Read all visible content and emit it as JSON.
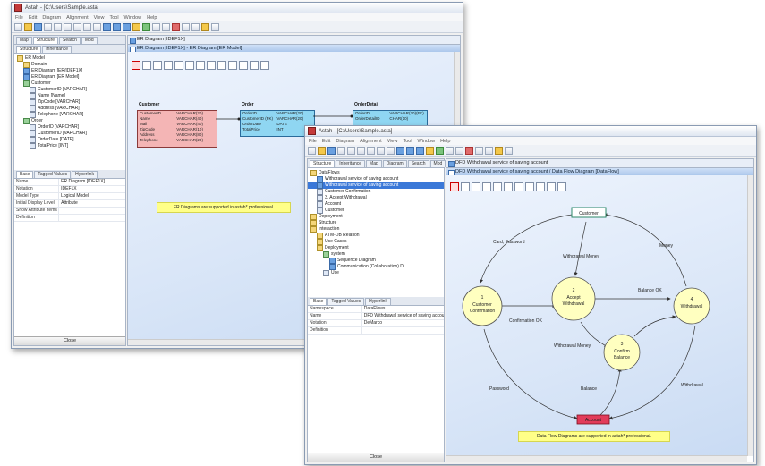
{
  "back_window": {
    "title": "Astah - [C:\\Users\\Sample.asta]",
    "menu": [
      "File",
      "Edit",
      "Diagram",
      "Alignment",
      "View",
      "Tool",
      "Window",
      "Help"
    ],
    "left_tabs": [
      "Map",
      "Structure",
      "Search",
      "Mod"
    ],
    "left_subtabs": [
      "Structure",
      "Inheritance"
    ],
    "tree": [
      {
        "label": "ER Model",
        "icon": "folder",
        "indent": 0
      },
      {
        "label": "Domain",
        "icon": "folder",
        "indent": 1
      },
      {
        "label": "ER Diagram [ER/IDEF1X]",
        "icon": "diagram",
        "indent": 1
      },
      {
        "label": "ER Diagram [ER Model]",
        "icon": "diagram",
        "indent": 1
      },
      {
        "label": "Customer",
        "icon": "entity",
        "indent": 1
      },
      {
        "label": "CustomerID [VARCHAR]",
        "icon": "attr",
        "indent": 2
      },
      {
        "label": "Name [Name]",
        "icon": "attr",
        "indent": 2
      },
      {
        "label": "ZipCode [VARCHAR]",
        "icon": "attr",
        "indent": 2
      },
      {
        "label": "Address [VARCHAR]",
        "icon": "attr",
        "indent": 2
      },
      {
        "label": "Telephone [VARCHAR]",
        "icon": "attr",
        "indent": 2
      },
      {
        "label": "Order",
        "icon": "entity",
        "indent": 1
      },
      {
        "label": "OrderID [VARCHAR]",
        "icon": "attr",
        "indent": 2
      },
      {
        "label": "CustomerID [VARCHAR]",
        "icon": "attr",
        "indent": 2
      },
      {
        "label": "OrderDate [DATE]",
        "icon": "attr",
        "indent": 2
      },
      {
        "label": "TotalPrice [INT]",
        "icon": "attr",
        "indent": 2
      }
    ],
    "prop_tabs": [
      "Base",
      "Tagged Values",
      "Hyperlink"
    ],
    "props": [
      {
        "k": "Name",
        "v": "ER Diagram [IDEF1X]"
      },
      {
        "k": "Notation",
        "v": "IDEF1X"
      },
      {
        "k": "Model Type",
        "v": "Logical Model"
      },
      {
        "k": "Initial Display Level",
        "v": "Attribute"
      },
      {
        "k": "Show Attribute Items",
        "v": ""
      },
      {
        "k": "Definition",
        "v": ""
      }
    ],
    "close_label": "Close",
    "doc_tab": "ER Diagram [IDEF1X]",
    "diagram_title": "ER Diagram [IDEF1X] - ER Diagram [ER Model]",
    "entities": {
      "customer": {
        "title": "Customer",
        "rows": [
          [
            "CustomerID",
            "VARCHAR(20)"
          ],
          [
            "Name",
            "VARCHAR(40)"
          ],
          [
            "Mail",
            "VARCHAR(40)"
          ],
          [
            "ZipCode",
            "VARCHAR(10)"
          ],
          [
            "Address",
            "VARCHAR(80)"
          ],
          [
            "Telephone",
            "VARCHAR(20)"
          ]
        ]
      },
      "order": {
        "title": "Order",
        "rows": [
          [
            "OrderID",
            "VARCHAR(20)"
          ],
          [
            "CustomerID (FK)",
            "VARCHAR(20)"
          ],
          [
            "OrderDate",
            "DATE"
          ],
          [
            "TotalPrice",
            "INT"
          ]
        ]
      },
      "orderdetail": {
        "title": "OrderDetail",
        "rows": [
          [
            "OrderID",
            "VARCHAR(20)(FK)"
          ],
          [
            "OrderDetailID",
            "CHAR(10)"
          ]
        ]
      }
    },
    "note": "ER Diagrams are supported in astah* professional."
  },
  "front_window": {
    "title": "Astah - [C:\\Users\\Sample.asta]",
    "menu": [
      "File",
      "Edit",
      "Diagram",
      "Alignment",
      "View",
      "Tool",
      "Window",
      "Help"
    ],
    "left_tabs": [
      "Structure",
      "Inheritance",
      "Map",
      "Diagram",
      "Search",
      "Mod"
    ],
    "tree": [
      {
        "label": "DataFlows",
        "icon": "folder",
        "indent": 0
      },
      {
        "label": "Withdrawal service of saving account",
        "icon": "diagram",
        "indent": 1
      },
      {
        "label": "Withdrawal service of saving account",
        "icon": "diagram",
        "indent": 1,
        "selected": true
      },
      {
        "label": "Customer Confirmation",
        "icon": "attr",
        "indent": 1
      },
      {
        "label": "3. Accept Withdrawal",
        "icon": "attr",
        "indent": 1
      },
      {
        "label": "Account",
        "icon": "attr",
        "indent": 1
      },
      {
        "label": "Customer",
        "icon": "attr",
        "indent": 1
      },
      {
        "label": "Deployment",
        "icon": "folder",
        "indent": 0
      },
      {
        "label": "Structure",
        "icon": "folder",
        "indent": 0
      },
      {
        "label": "Interaction",
        "icon": "folder",
        "indent": 0
      },
      {
        "label": "ATM-DB Relation",
        "icon": "folder",
        "indent": 1
      },
      {
        "label": "Use Cases",
        "icon": "folder",
        "indent": 1
      },
      {
        "label": "Deployment",
        "icon": "folder",
        "indent": 1
      },
      {
        "label": "system",
        "icon": "entity",
        "indent": 2
      },
      {
        "label": "Sequence Diagram",
        "icon": "diagram",
        "indent": 3
      },
      {
        "label": "Communication (Collaboration) D...",
        "icon": "diagram",
        "indent": 3
      },
      {
        "label": "Use",
        "icon": "attr",
        "indent": 2
      }
    ],
    "prop_tabs": [
      "Base",
      "Tagged Values",
      "Hyperlink"
    ],
    "props": [
      {
        "k": "Namespace",
        "v": "DataFlows"
      },
      {
        "k": "Name",
        "v": "DFD Withdrawal service of saving account"
      },
      {
        "k": "Notation",
        "v": "DeMarco"
      },
      {
        "k": "Definition",
        "v": ""
      }
    ],
    "close_label": "Close",
    "doc_tab": "DFD Withdrawal service of saving account",
    "diagram_title": "DFD Withdrawal service of saving account / Data Flow Diagram [DataFlow]",
    "dfd": {
      "customer": "Customer",
      "account": "Account",
      "p1": [
        "1",
        "Customer",
        "Confirmation"
      ],
      "p2": [
        "2",
        "Accept",
        "Withdrawal"
      ],
      "p3": [
        "3",
        "Confirm",
        "Balance"
      ],
      "p4": [
        "4",
        "Withdrawal"
      ],
      "flows": {
        "card_password": "Card, Password",
        "money": "Money",
        "withdrawal_money": "Withdrawal Money",
        "balance_ok": "Balance OK",
        "confirmation_ok": "Confirmation OK",
        "withdrawal_money2": "Withdrawal Money",
        "balance": "Balance",
        "password": "Password",
        "withdrawal": "Withdrawal"
      },
      "note": "Data Flow Diagrams are supported in astah* professional."
    }
  },
  "colors": {
    "entity_pink": "#f4b5b5",
    "entity_blue": "#8fd6f2",
    "process_yellow": "#ffffc0",
    "store_red": "#e23c5a",
    "note_yellow": "#ffff88"
  }
}
